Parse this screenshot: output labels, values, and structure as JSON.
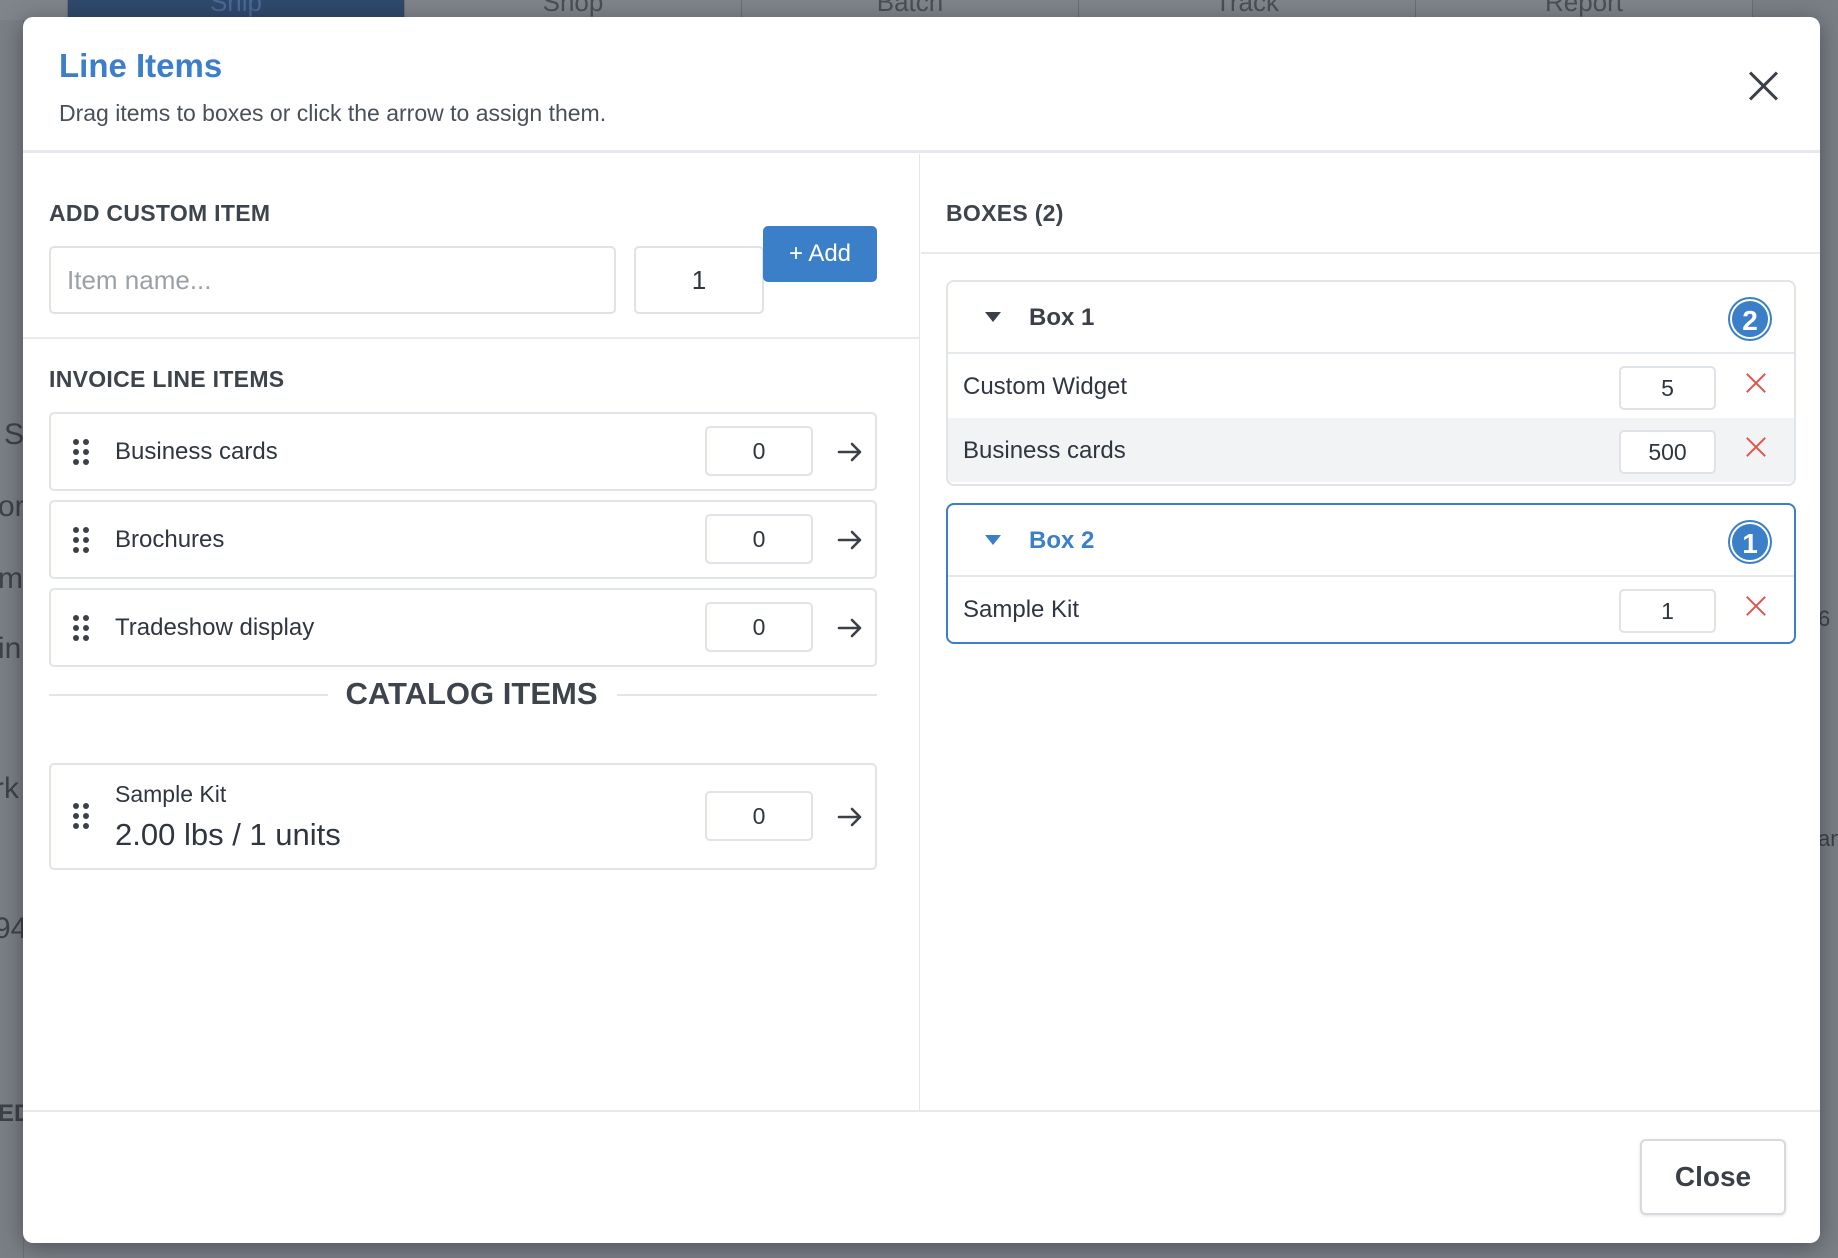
{
  "background": {
    "nav_tabs": [
      "Ship",
      "Shop",
      "Batch",
      "Track",
      "Report"
    ],
    "fragments": [
      "S",
      "om",
      "mi",
      "in",
      "rk",
      "94",
      "ED",
      "6",
      "an"
    ]
  },
  "modal": {
    "title": "Line Items",
    "subtitle": "Drag items to boxes or click the arrow to assign them.",
    "close_icon": "close-icon"
  },
  "custom_item": {
    "heading": "ADD CUSTOM ITEM",
    "name_placeholder": "Item name...",
    "name_value": "",
    "quantity": "1",
    "add_label": "+ Add"
  },
  "invoice": {
    "heading": "INVOICE LINE ITEMS",
    "items": [
      {
        "name": "Business cards",
        "qty": "0"
      },
      {
        "name": "Brochures",
        "qty": "0"
      },
      {
        "name": "Tradeshow display",
        "qty": "0"
      }
    ]
  },
  "catalog": {
    "heading": "CATALOG ITEMS",
    "items": [
      {
        "name": "Sample Kit",
        "detail": "2.00 lbs / 1 units",
        "qty": "0"
      }
    ]
  },
  "boxes": {
    "heading": "BOXES (2)",
    "list": [
      {
        "name": "Box 1",
        "count": "2",
        "items": [
          {
            "name": "Custom Widget",
            "qty": "5"
          },
          {
            "name": "Business cards",
            "qty": "500"
          }
        ]
      },
      {
        "name": "Box 2",
        "count": "1",
        "items": [
          {
            "name": "Sample Kit",
            "qty": "1"
          }
        ]
      }
    ]
  },
  "footer": {
    "close_label": "Close"
  },
  "colors": {
    "accent": "#3a7fc7",
    "danger": "#e0554f",
    "text": "#2f3640"
  }
}
